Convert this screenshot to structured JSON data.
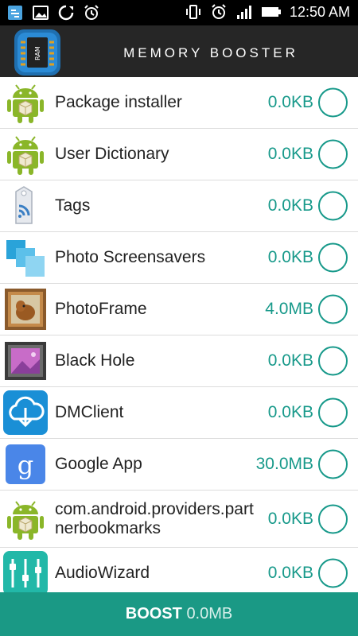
{
  "status_bar": {
    "time": "12:50 AM",
    "left_icons": [
      "screenshot-icon",
      "image-icon",
      "sync-icon",
      "alarm-icon"
    ],
    "right_icons": [
      "vibrate-icon",
      "alarm-icon",
      "signal-icon",
      "battery-icon"
    ]
  },
  "app_bar": {
    "title": "MEMORY BOOSTER",
    "logo_text": "RAM"
  },
  "list": {
    "items": [
      {
        "name": "Package installer",
        "size": "0.0KB",
        "icon": "android-icon"
      },
      {
        "name": "User Dictionary",
        "size": "0.0KB",
        "icon": "android-icon"
      },
      {
        "name": "Tags",
        "size": "0.0KB",
        "icon": "tags-icon"
      },
      {
        "name": "Photo Screensavers",
        "size": "0.0KB",
        "icon": "photo-screensavers-icon"
      },
      {
        "name": "PhotoFrame",
        "size": "4.0MB",
        "icon": "photoframe-icon"
      },
      {
        "name": "Black Hole",
        "size": "0.0KB",
        "icon": "black-hole-icon"
      },
      {
        "name": "DMClient",
        "size": "0.0KB",
        "icon": "dmclient-icon"
      },
      {
        "name": "Google App",
        "size": "30.0MB",
        "icon": "google-icon"
      },
      {
        "name": "com.android.providers.partnerbookmarks",
        "size": "0.0KB",
        "icon": "android-icon"
      },
      {
        "name": "AudioWizard",
        "size": "0.0KB",
        "icon": "audiowizard-icon"
      }
    ]
  },
  "boost": {
    "label": "BOOST",
    "value": "0.0MB"
  },
  "colors": {
    "accent": "#1a9985",
    "app_bar": "#262626",
    "size_text": "#17998a"
  }
}
